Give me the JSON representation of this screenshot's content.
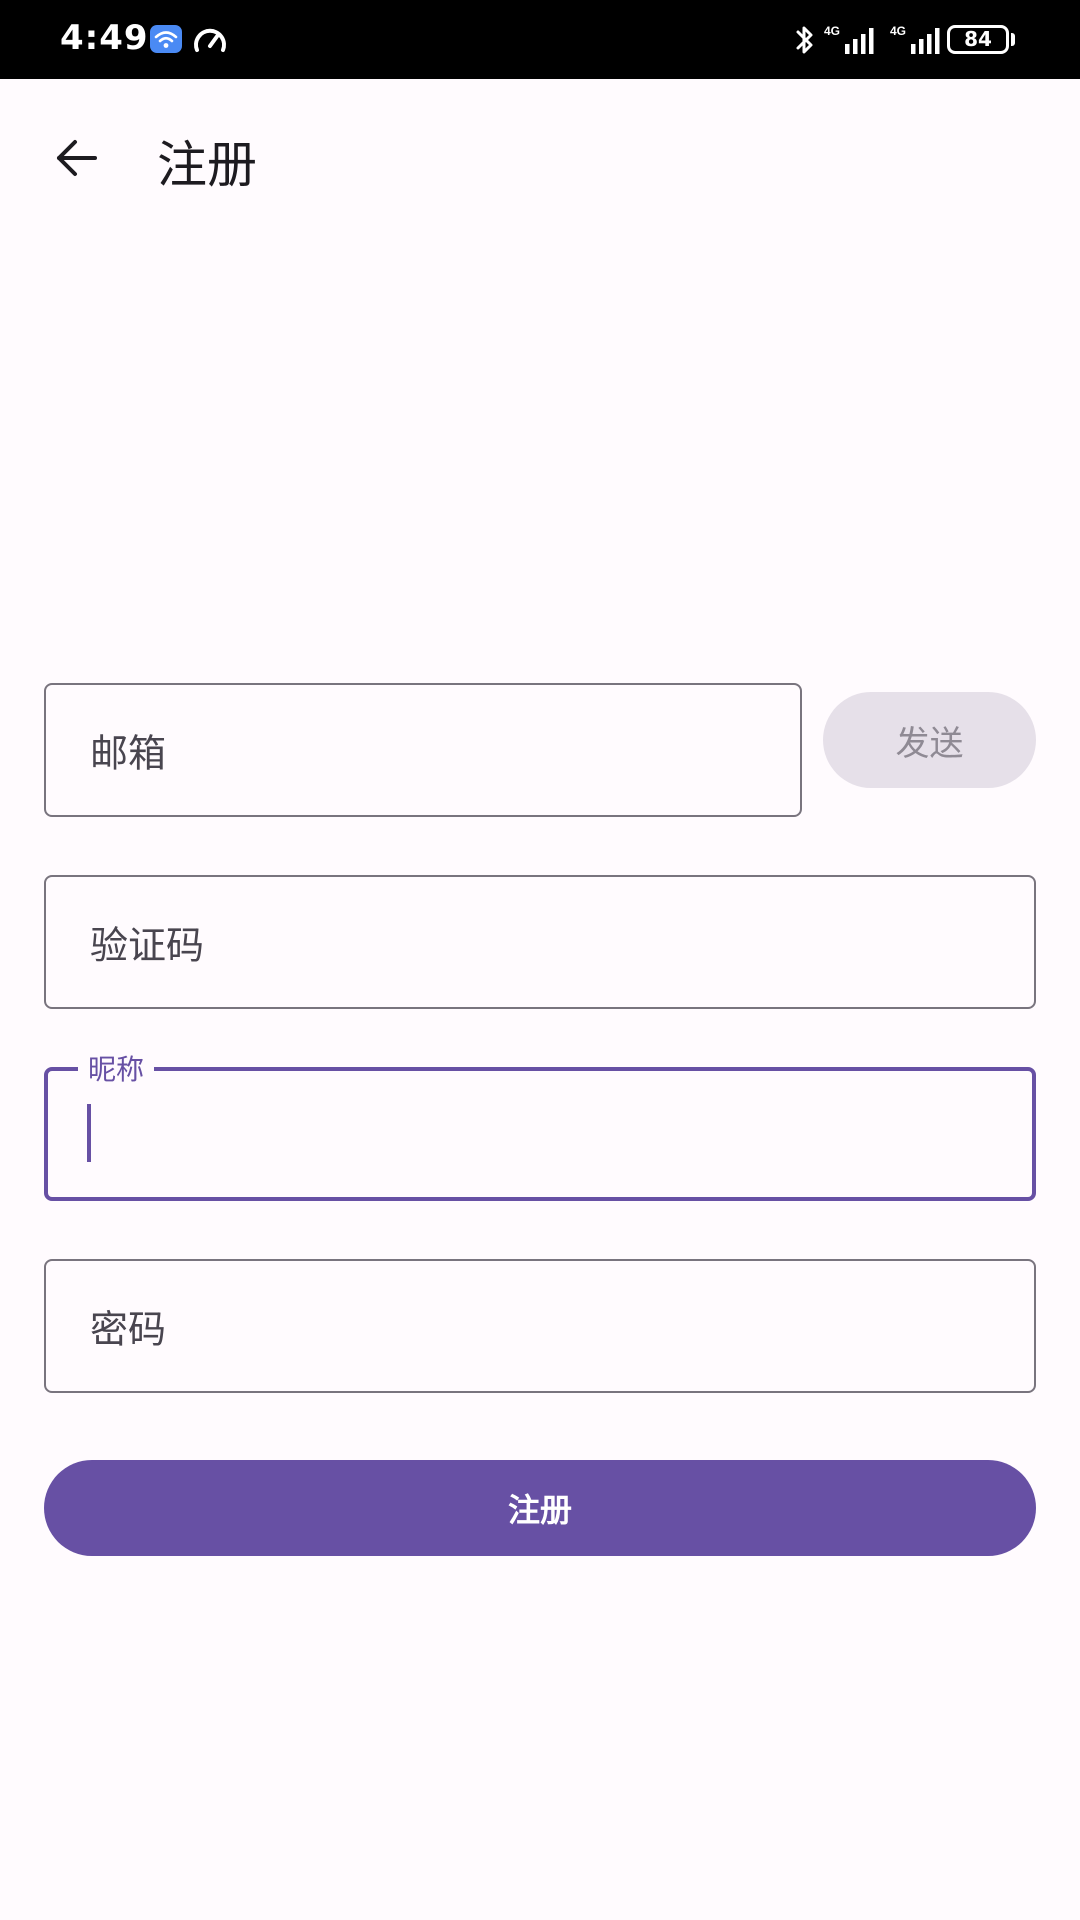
{
  "status_bar": {
    "time": "4:49",
    "signal_label": "4G",
    "battery": "84",
    "icons": [
      "wifi-icon",
      "speed-icon",
      "bluetooth-icon",
      "cell-signal-icon",
      "battery-icon"
    ]
  },
  "app_bar": {
    "title": "注册",
    "back_icon": "arrow-left-icon"
  },
  "form": {
    "email": {
      "label": "邮箱",
      "value": ""
    },
    "send_button": "发送",
    "code": {
      "label": "验证码",
      "value": ""
    },
    "nickname": {
      "label": "昵称",
      "value": ""
    },
    "password": {
      "label": "密码",
      "value": ""
    },
    "submit_button": "注册"
  },
  "colors": {
    "primary": "#6750a4",
    "background": "#fffbfe",
    "outline": "#79747e",
    "disabled_container": "#e6e0e9"
  }
}
